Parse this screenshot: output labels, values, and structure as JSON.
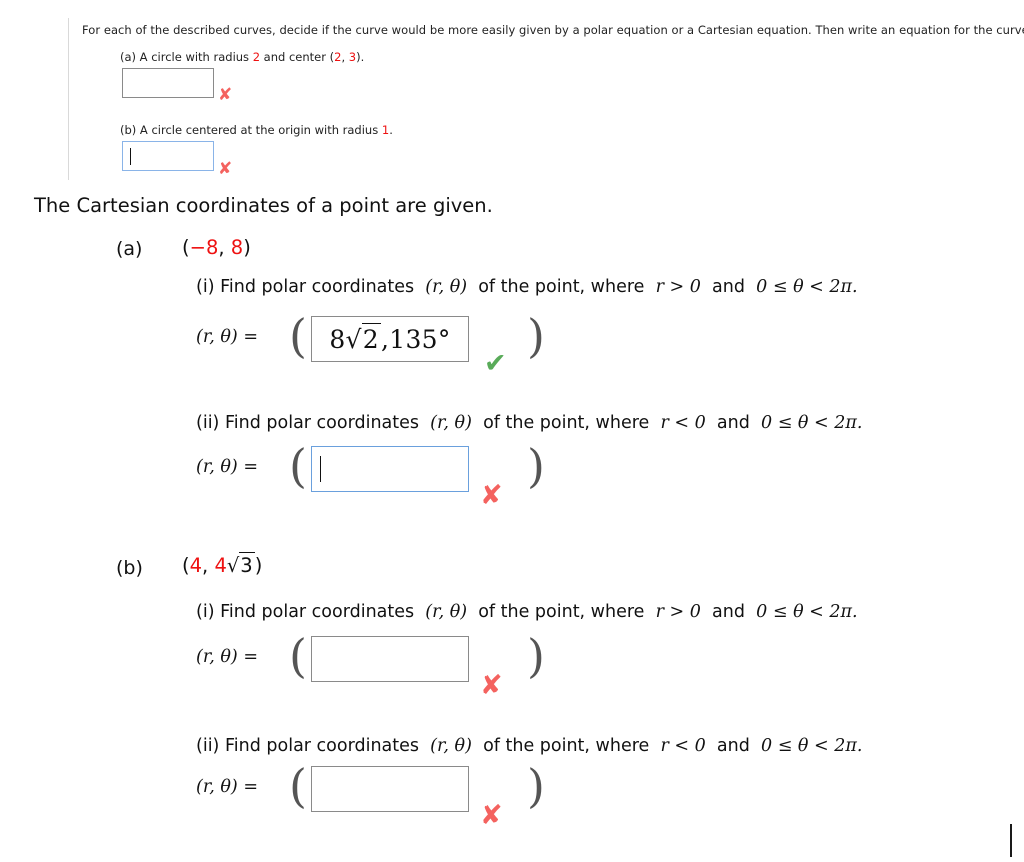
{
  "top_block": {
    "prompt": "For each of the described curves, decide if the curve would be more easily given by a polar equation or a Cartesian equation. Then write an equation for the curve.",
    "parts": [
      {
        "label_prefix": "(a) A circle with radius ",
        "value_1": "2",
        "label_mid": " and center (",
        "value_2": "2",
        "label_sep": ", ",
        "value_3": "3",
        "label_end": ").",
        "input_value": "",
        "focused": false,
        "mark": "✘"
      },
      {
        "label_prefix": "(b) A circle centered at the origin with radius ",
        "value_1": "1",
        "label_end": ".",
        "input_value": "",
        "focused": true,
        "mark": "✘"
      }
    ]
  },
  "main": {
    "heading": "The Cartesian coordinates of a point are given.",
    "parts": [
      {
        "label": "(a)",
        "point_open": "(",
        "point_x": "−8",
        "point_sep": ", ",
        "point_y": "8",
        "point_close": ")",
        "sub": [
          {
            "roman": "(i)",
            "text_1": "Find polar coordinates",
            "coord": "(r, θ)",
            "text_2": "of the point, where",
            "cond_1": "r > 0",
            "and": "and",
            "cond_2": "0 ≤ θ < 2π.",
            "answer_prefix": "(r, θ) =",
            "answer_value": "8√2 ,135°",
            "answer_coeff": "8",
            "answer_radicand": "2",
            "answer_tail": ",135°",
            "focused": false,
            "mark": "✔",
            "mark_type": "correct"
          },
          {
            "roman": "(ii)",
            "text_1": "Find polar coordinates",
            "coord": "(r, θ)",
            "text_2": "of the point, where",
            "cond_1": "r < 0",
            "and": "and",
            "cond_2": "0 ≤ θ < 2π.",
            "answer_prefix": "(r, θ) =",
            "answer_value": "",
            "focused": true,
            "mark": "✘",
            "mark_type": "incorrect"
          }
        ]
      },
      {
        "label": "(b)",
        "point_open": "(",
        "point_x": "4",
        "point_sep": ", ",
        "point_y_coeff": "4",
        "point_y_radicand": "3",
        "point_close": ")",
        "sub": [
          {
            "roman": "(i)",
            "text_1": "Find polar coordinates",
            "coord": "(r, θ)",
            "text_2": "of the point, where",
            "cond_1": "r > 0",
            "and": "and",
            "cond_2": "0 ≤ θ < 2π.",
            "answer_prefix": "(r, θ) =",
            "answer_value": "",
            "focused": false,
            "mark": "✘",
            "mark_type": "incorrect"
          },
          {
            "roman": "(ii)",
            "text_1": "Find polar coordinates",
            "coord": "(r, θ)",
            "text_2": "of the point, where",
            "cond_1": "r < 0",
            "and": "and",
            "cond_2": "0 ≤ θ < 2π.",
            "answer_prefix": "(r, θ) =",
            "answer_value": "",
            "focused": false,
            "mark": "✘",
            "mark_type": "incorrect"
          }
        ]
      }
    ]
  },
  "symbols": {
    "cross": "✘",
    "check": "✔",
    "paren_open": "(",
    "paren_close": ")",
    "radical": "√"
  },
  "colors": {
    "value_red": "#ee1111",
    "mark_incorrect": "#f4625f",
    "mark_correct": "#59ab59",
    "focus_border": "#6aa0dd",
    "idle_border": "#8a8a8a"
  }
}
